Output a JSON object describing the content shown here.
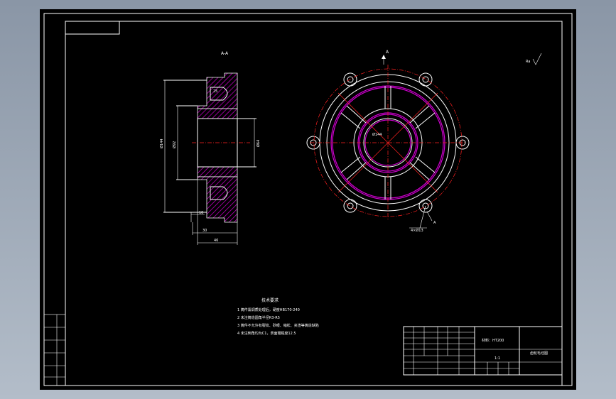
{
  "section_label": "A-A",
  "view_arrow_label": "A",
  "roughness_label": "Ra",
  "dimensions": {
    "d_outer": "Ø144",
    "d_mid": "Ø92",
    "d_inner": "Ø64",
    "height_small": "25",
    "width_10": "10",
    "width_30": "30",
    "width_46": "46",
    "d_bore_front": "Ø144",
    "holes": "4×Ø13"
  },
  "technical_requirements": {
    "title": "技术要求",
    "items": [
      "1  铸件需调质处理后，硬度HB170-240",
      "2  未注铸造圆角半径R3-R5",
      "3  铸件不允许有裂纹、砂眼、缩松、夹渣等铸造缺陷",
      "4  未注倒角均为C1，表面粗糙度12.5"
    ]
  },
  "title_block": {
    "material": "材料：HT200",
    "part_name": "齿轮毛坯图",
    "scale": "1:1"
  },
  "colors": {
    "background": "#000000",
    "frame": "#ffffff",
    "centerline": "#ff2020",
    "hidden": "#d000d0"
  }
}
